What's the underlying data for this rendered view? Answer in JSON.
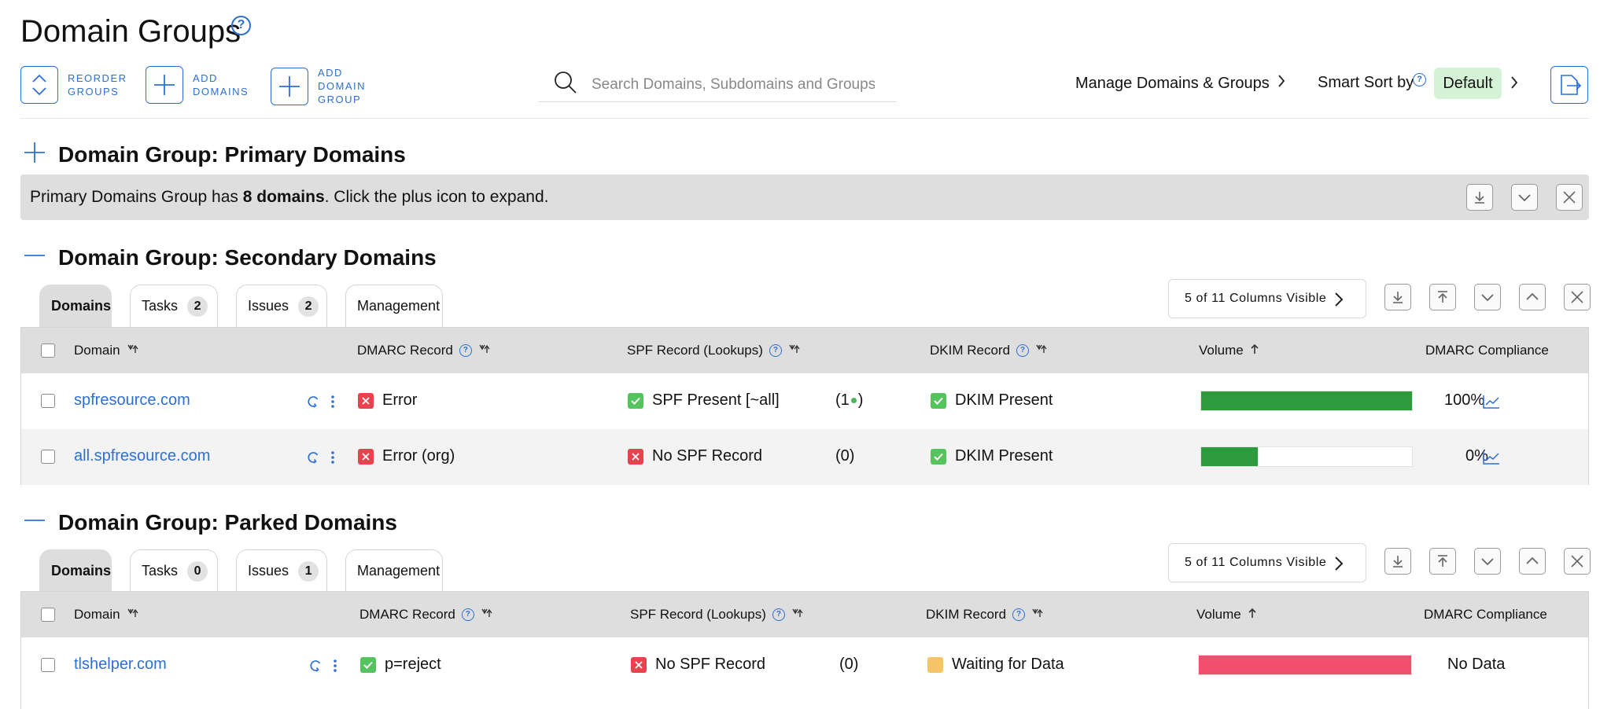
{
  "page": {
    "title": "Domain Groups"
  },
  "toolbar": {
    "reorder_label_1": "REORDER",
    "reorder_label_2": "GROUPS",
    "add_domains_label_1": "ADD",
    "add_domains_label_2": "DOMAINS",
    "add_group_label_1": "ADD",
    "add_group_label_2": "DOMAIN",
    "add_group_label_3": "GROUP",
    "search_placeholder": "Search Domains, Subdomains and Groups",
    "manage_label": "Manage Domains & Groups",
    "smart_sort_label": "Smart Sort by",
    "smart_sort_value": "Default"
  },
  "groups": {
    "primary": {
      "title": "Domain Group: Primary Domains",
      "summary_prefix": "Primary Domains Group has ",
      "summary_bold": "8 domains",
      "summary_suffix": ". Click the plus icon to expand."
    },
    "secondary": {
      "title": "Domain Group: Secondary Domains",
      "tabs": {
        "domains": "Domains",
        "tasks": "Tasks",
        "tasks_count": "2",
        "issues": "Issues",
        "issues_count": "2",
        "management": "Management"
      },
      "columns_visible": "5 of 11 Columns Visible",
      "headers": {
        "domain": "Domain",
        "dmarc": "DMARC Record",
        "spf": "SPF Record (Lookups)",
        "dkim": "DKIM Record",
        "volume": "Volume",
        "compliance": "DMARC Compliance"
      },
      "rows": [
        {
          "domain": "spfresource.com",
          "dmarc": "Error",
          "dmarc_status": "error",
          "spf": "SPF Present [~all]",
          "spf_status": "ok",
          "lookups_open": "(1",
          "lookups_close": ")",
          "dkim": "DKIM Present",
          "dkim_status": "ok",
          "volume_fraction": 1.0,
          "compliance": "100%"
        },
        {
          "domain": "all.spfresource.com",
          "dmarc": "Error (org)",
          "dmarc_status": "error",
          "spf": "No SPF Record",
          "spf_status": "error",
          "lookups": "(0)",
          "dkim": "DKIM Present",
          "dkim_status": "ok",
          "volume_fraction": 0.27,
          "compliance": "0%"
        }
      ]
    },
    "parked": {
      "title": "Domain Group: Parked Domains",
      "tabs": {
        "domains": "Domains",
        "tasks": "Tasks",
        "tasks_count": "0",
        "issues": "Issues",
        "issues_count": "1",
        "management": "Management"
      },
      "columns_visible": "5 of 11 Columns Visible",
      "headers": {
        "domain": "Domain",
        "dmarc": "DMARC Record",
        "spf": "SPF Record (Lookups)",
        "dkim": "DKIM Record",
        "volume": "Volume",
        "compliance": "DMARC Compliance"
      },
      "rows": [
        {
          "domain": "tlshelper.com",
          "dmarc": "p=reject",
          "dmarc_status": "ok",
          "spf": "No SPF Record",
          "spf_status": "error",
          "lookups": "(0)",
          "dkim": "Waiting for Data",
          "dkim_status": "waiting",
          "volume_fraction": 1.0,
          "compliance": "No Data"
        }
      ]
    }
  },
  "colors": {
    "accent": "#2d6fd4",
    "volume_green": "#2e9a3e",
    "volume_pink": "#f0506e",
    "status_error": "#e8424f",
    "status_ok": "#55c45e",
    "status_waiting": "#f5c466"
  }
}
